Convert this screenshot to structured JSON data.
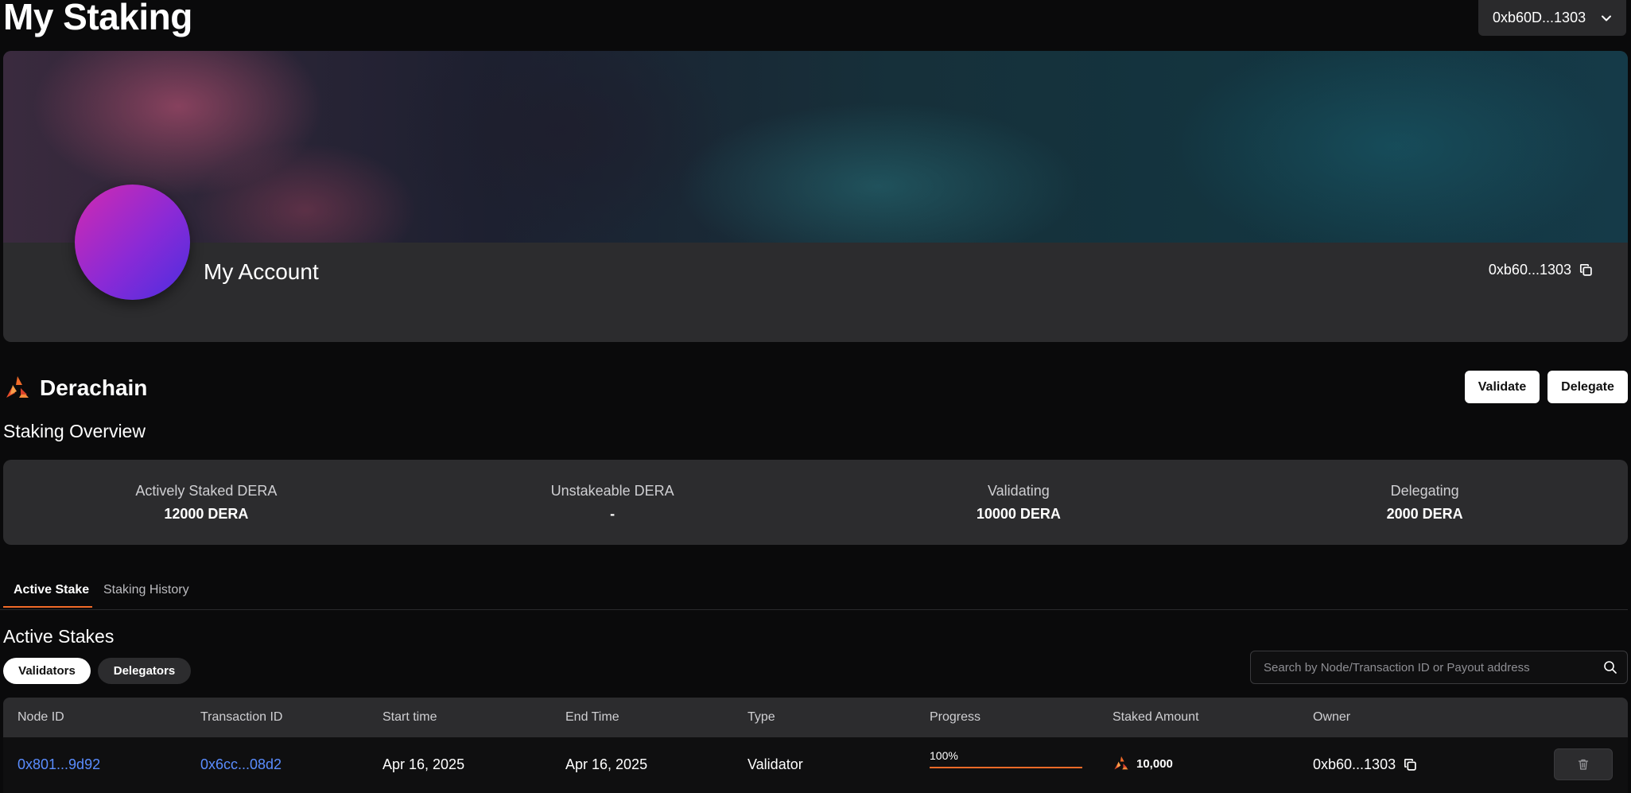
{
  "page": {
    "title": "My Staking"
  },
  "wallet": {
    "address": "0xb60D...1303"
  },
  "account": {
    "name": "My Account",
    "address": "0xb60...1303",
    "avatar_colors": [
      "#d22ab0",
      "#4b2ee0"
    ]
  },
  "brand": {
    "name": "Derachain",
    "accent": "#f06a28"
  },
  "actions": {
    "validate_label": "Validate",
    "delegate_label": "Delegate"
  },
  "overview": {
    "heading": "Staking Overview",
    "stats": [
      {
        "label": "Actively Staked DERA",
        "value": "12000 DERA"
      },
      {
        "label": "Unstakeable DERA",
        "value": "-"
      },
      {
        "label": "Validating",
        "value": "10000 DERA"
      },
      {
        "label": "Delegating",
        "value": "2000 DERA"
      }
    ]
  },
  "tabs": {
    "active": "Active Stake",
    "history": "Staking History"
  },
  "active_stakes": {
    "heading": "Active Stakes",
    "filters": {
      "validators": "Validators",
      "delegators": "Delegators",
      "selected": "Validators"
    },
    "search": {
      "placeholder": "Search by Node/Transaction ID or Payout address",
      "value": ""
    },
    "columns": [
      "Node ID",
      "Transaction ID",
      "Start time",
      "End Time",
      "Type",
      "Progress",
      "Staked Amount",
      "Owner"
    ],
    "rows": [
      {
        "node_id": "0x801...9d92",
        "transaction_id": "0x6cc...08d2",
        "start_time": "Apr 16, 2025",
        "end_time": "Apr 16, 2025",
        "type": "Validator",
        "progress_label": "100%",
        "progress": 1.0,
        "staked_amount": "10,000",
        "owner": "0xb60...1303"
      }
    ]
  },
  "icons": [
    "chevron-down-icon",
    "copy-icon",
    "derachain-logo",
    "search-icon",
    "trash-icon"
  ]
}
